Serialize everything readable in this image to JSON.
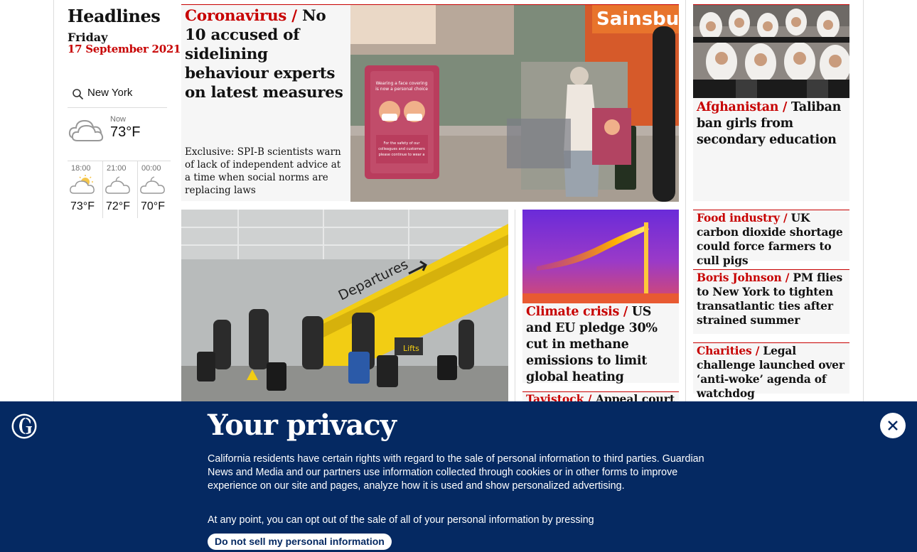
{
  "sidebar": {
    "title": "Headlines",
    "day": "Friday",
    "date": "17 September 2021",
    "location": "New York",
    "now_label": "Now",
    "now_temp": "73°F",
    "forecast": [
      {
        "time": "18:00",
        "temp": "73°F",
        "icon": "partly-sunny-icon"
      },
      {
        "time": "21:00",
        "temp": "72°F",
        "icon": "cloud-night-icon"
      },
      {
        "time": "00:00",
        "temp": "70°F",
        "icon": "cloud-night-icon"
      }
    ]
  },
  "lead": {
    "kicker": "Coronavirus /",
    "headline": "No 10 accused of sidelining behaviour experts on latest measures",
    "standfirst": "Exclusive: SPI-B scientists warn of lack of independent advice at a time when social norms are replacing laws"
  },
  "climate": {
    "kicker": "Climate crisis /",
    "headline": "US and EU pledge 30% cut in methane emissions to limit global heating"
  },
  "tavistock": {
    "kicker": "Tavistock /",
    "headline": "Appeal court"
  },
  "afghanistan": {
    "kicker": "Afghanistan /",
    "headline": "Taliban ban girls from secondary education"
  },
  "right_stories": [
    {
      "kicker": "Food industry /",
      "headline": "UK carbon dioxide shortage could force farmers to cull pigs"
    },
    {
      "kicker": "Boris Johnson /",
      "headline": "PM flies to New York to tighten transatlantic ties after strained summer"
    },
    {
      "kicker": "Charities /",
      "headline": "Legal challenge launched over ‘anti-woke’ agenda of watchdog"
    }
  ],
  "images": {
    "lead_sign": "Wearing a face covering if you can is now a personal choice",
    "lead_sign_small": "For the safety of our colleagues and customers please continue to wear a face covering if you can",
    "store_name": "Sainsbury's Taplow",
    "airport_sign": "Departures",
    "airport_lifts": "Lifts"
  },
  "privacy": {
    "title": "Your privacy",
    "body": "California residents have certain rights with regard to the sale of personal information to third parties. Guardian News and Media and our partners use information collected through cookies or in other forms to improve experience on our site and pages, analyze how it is used and show personalized advertising.",
    "body2": "At any point, you can opt out of the sale of all of your personal information by pressing",
    "button": "Do not sell my personal information"
  },
  "colors": {
    "brand_red": "#c70000",
    "banner_blue": "#052962",
    "card_bg": "#f6f6f6"
  }
}
